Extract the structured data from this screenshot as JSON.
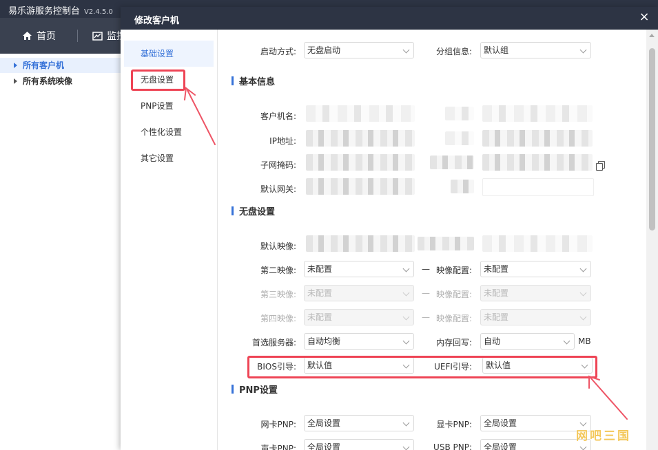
{
  "app": {
    "title": "易乐游服务控制台",
    "version": "V2.4.5.0",
    "nav": {
      "home": "首页",
      "monitor": "监控"
    },
    "tree": [
      {
        "label": "所有客户机",
        "active": true
      },
      {
        "label": "所有系统映像",
        "active": false
      }
    ]
  },
  "dialog": {
    "title": "修改客户机",
    "close": "×",
    "sidebar": [
      {
        "label": "基础设置",
        "active": true
      },
      {
        "label": "无盘设置",
        "active": false
      },
      {
        "label": "PNP设置",
        "active": false
      },
      {
        "label": "个性化设置",
        "active": false
      },
      {
        "label": "其它设置",
        "active": false
      }
    ],
    "top_row": {
      "boot_mode_label": "启动方式:",
      "boot_mode_value": "无盘启动",
      "group_label": "分组信息:",
      "group_value": "默认组"
    },
    "basic": {
      "section": "基本信息",
      "client_name_label": "客户机名:",
      "ip_label": "IP地址:",
      "subnet_label": "子网掩码:",
      "gateway_label": "默认网关:"
    },
    "diskless": {
      "section": "无盘设置",
      "default_image_label": "默认映像:",
      "second_image_label": "第二映像:",
      "second_image_value": "未配置",
      "second_config_label": "映像配置:",
      "second_config_value": "未配置",
      "third_image_label": "第三映像:",
      "third_image_value": "未配置",
      "third_config_label": "映像配置:",
      "third_config_value": "未配置",
      "fourth_image_label": "第四映像:",
      "fourth_image_value": "未配置",
      "fourth_config_label": "映像配置:",
      "fourth_config_value": "未配置",
      "dash": "—",
      "preferred_server_label": "首选服务器:",
      "preferred_server_value": "自动均衡",
      "memory_writeback_label": "内存回写:",
      "memory_writeback_value": "自动",
      "memory_unit": "MB",
      "bios_boot_label": "BIOS引导:",
      "bios_boot_value": "默认值",
      "uefi_boot_label": "UEFI引导:",
      "uefi_boot_value": "默认值"
    },
    "pnp": {
      "section": "PNP设置",
      "nic_label": "网卡PNP:",
      "nic_value": "全局设置",
      "gpu_label": "显卡PNP:",
      "gpu_value": "全局设置",
      "sound_label": "声卡PNP:",
      "sound_value": "全局设置",
      "usb_label": "USB PNP:",
      "usb_value": "全局设置"
    }
  },
  "watermark": "网吧三国",
  "colors": {
    "accent": "#3672d8",
    "highlight": "#ee4455",
    "header": "#2d3444"
  }
}
